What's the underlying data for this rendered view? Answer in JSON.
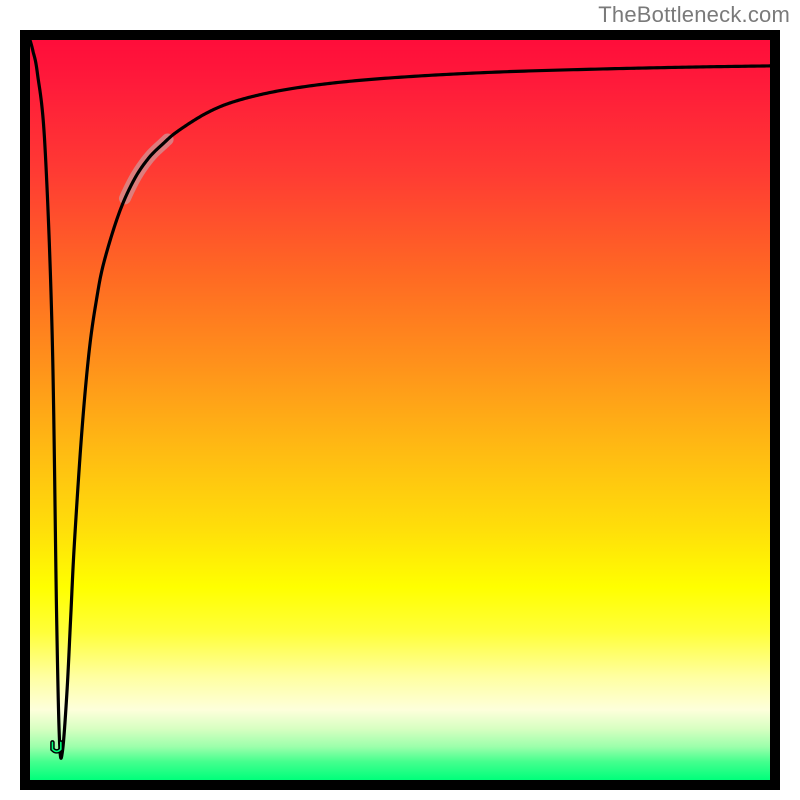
{
  "attribution": "TheBottleneck.com",
  "chart_data": {
    "type": "line",
    "title": "",
    "xlabel": "",
    "ylabel": "",
    "xlim": [
      0,
      100
    ],
    "ylim": [
      0,
      100
    ],
    "background_gradient_stops": [
      {
        "pct": 0,
        "color": "#ff0d3a"
      },
      {
        "pct": 18,
        "color": "#ff3b33"
      },
      {
        "pct": 44,
        "color": "#ff921b"
      },
      {
        "pct": 66,
        "color": "#ffde0a"
      },
      {
        "pct": 80,
        "color": "#ffff39"
      },
      {
        "pct": 93,
        "color": "#d9ffc2"
      },
      {
        "pct": 100,
        "color": "#00ff7b"
      }
    ],
    "series": [
      {
        "name": "bottleneck-curve",
        "x": [
          0.0,
          0.4,
          1.0,
          2.0,
          3.0,
          3.6,
          4.0,
          4.4,
          5.0,
          5.5,
          6.0,
          7.0,
          8.0,
          9.0,
          10.0,
          12.0,
          14.0,
          16.0,
          18.0,
          20.0,
          24.0,
          28.0,
          34.0,
          42.0,
          52.0,
          64.0,
          78.0,
          90.0,
          100.0
        ],
        "y": [
          100,
          98.5,
          95.5,
          86,
          60,
          22,
          5,
          4,
          12,
          22,
          32,
          47,
          58,
          65,
          70,
          76.5,
          81,
          84,
          86,
          87.7,
          90.2,
          91.8,
          93.2,
          94.3,
          95.1,
          95.7,
          96.1,
          96.35,
          96.5
        ]
      }
    ],
    "highlight": {
      "on_series": "bottleneck-curve",
      "x_range": [
        12.8,
        18.6
      ],
      "color": "#d48f92",
      "thickness_px": 12
    },
    "notch_marker": {
      "x": 3.6,
      "y": 4.3,
      "outer_color": "#000000",
      "inner_color": "#00ff7b"
    }
  }
}
